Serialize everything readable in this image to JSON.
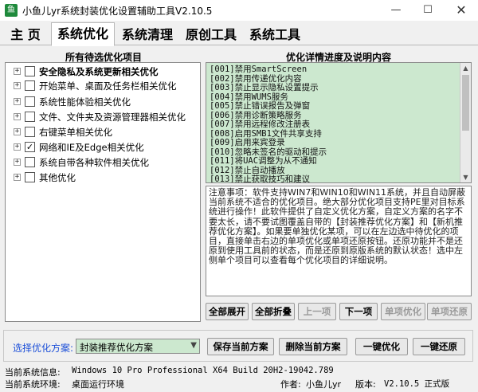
{
  "window": {
    "title": "小鱼儿yr系统封装优化设置辅助工具V2.10.5",
    "minimize": "—",
    "maximize": "☐",
    "close": "✕"
  },
  "tabs": [
    {
      "label": "主 页"
    },
    {
      "label": "系统优化"
    },
    {
      "label": "系统清理"
    },
    {
      "label": "原创工具"
    },
    {
      "label": "系统工具"
    }
  ],
  "left_panel": {
    "title": "所有待选优化项目",
    "items": [
      {
        "label": "安全隐私及系统更新相关优化",
        "checked": false,
        "bold": true
      },
      {
        "label": "开始菜单、桌面及任务栏相关优化",
        "checked": false,
        "bold": false
      },
      {
        "label": "系统性能体验相关优化",
        "checked": false,
        "bold": false
      },
      {
        "label": "文件、文件夹及资源管理器相关优化",
        "checked": false,
        "bold": false
      },
      {
        "label": "右键菜单相关优化",
        "checked": false,
        "bold": false
      },
      {
        "label": "网络和IE及Edge相关优化",
        "checked": true,
        "bold": false
      },
      {
        "label": "系统自带各种软件相关优化",
        "checked": false,
        "bold": false
      },
      {
        "label": "其他优化",
        "checked": false,
        "bold": false
      }
    ]
  },
  "right_panel": {
    "title": "优化详情进度及说明内容",
    "items": [
      "[001]禁用SmartScreen",
      "[002]禁用传递优化内容",
      "[003]禁止显示隐私设置提示",
      "[004]禁用WUMS服务",
      "[005]禁止错误报告及弹窗",
      "[006]禁用诊断策略服务",
      "[007]禁用远程修改注册表",
      "[008]启用SMB1文件共享支持",
      "[009]启用来宾登录",
      "[010]忽略未签名的驱动和提示",
      "[011]将UAC调整为从不通知",
      "[012]禁止自动播放",
      "[013]禁止获取技巧和建议"
    ],
    "note": "注意事项：软件支持WIN7和WIN10和WIN11系统，并且自动屏蔽当前系统不适合的优化项目。绝大部分优化项目支持PE里对目标系统进行操作！此软件提供了自定义优化方案，自定义方案的名字不要太长，请不要试图覆盖自带的【封装推荐优化方案】和【新机推荐优化方案】。如果要单独优化某项，可以在左边选中待优化的项目，直接单击右边的单项优化或单项还原按钮。还原功能并不是还原到使用工具前的状态，而是还原到原版系统的默认状态！选中左侧单个项目可以查看每个优化项目的详细说明。"
  },
  "action_buttons": {
    "expand_all": "全部展开",
    "collapse_all": "全部折叠",
    "prev": "上一项",
    "next": "下一项",
    "single_optimize": "单项优化",
    "single_restore": "单项还原"
  },
  "plan": {
    "label": "选择优化方案:",
    "selected": "封装推荐优化方案",
    "save": "保存当前方案",
    "delete": "删除当前方案",
    "optimize_all": "一键优化",
    "restore_all": "一键还原"
  },
  "status": {
    "sysinfo_label": "当前系统信息:",
    "sysinfo_value": "Windows 10 Pro Professional X64 Build 20H2-19042.789",
    "env_label": "当前系统环境:",
    "env_value": "桌面运行环境",
    "author_label": "作者:",
    "author_value": "小鱼儿yr",
    "version_label": "版本:",
    "version_value": "V2.10.5 正式版"
  }
}
